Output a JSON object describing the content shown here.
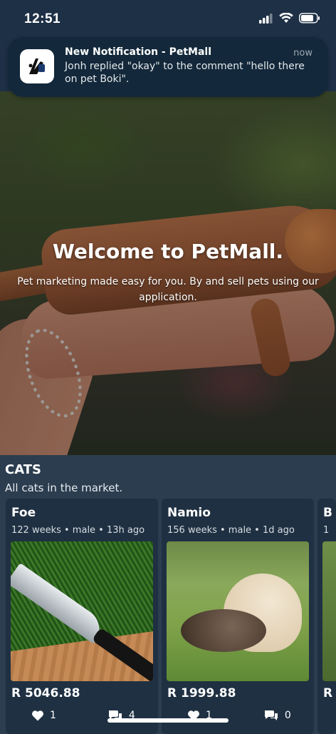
{
  "status": {
    "time": "12:51"
  },
  "notification": {
    "title": "New Notification - PetMall",
    "time": "now",
    "body": "Jonh replied \"okay\" to the comment \"hello there on pet Boki\"."
  },
  "hero": {
    "title": "Welcome to PetMall.",
    "subtitle": "Pet marketing made easy for you. By and sell pets using our application."
  },
  "section": {
    "title": "CATS",
    "subtitle": "All cats in the market.",
    "cards": [
      {
        "name": "Foe",
        "meta": "122 weeks • male • 13h ago",
        "price": "R 5046.88",
        "likes": "1",
        "comments": "4",
        "photo_icon": "greens-knife-photo"
      },
      {
        "name": "Namio",
        "meta": "156 weeks • male • 1d ago",
        "price": "R 1999.88",
        "likes": "1",
        "comments": "0",
        "photo_icon": "dog-cat-photo"
      },
      {
        "name": "B",
        "meta": "1",
        "price": "R",
        "likes": "",
        "comments": ""
      }
    ]
  },
  "colors": {
    "background": "#2b3d4f",
    "card": "#1f3042",
    "status_bar": "#1e3046"
  }
}
